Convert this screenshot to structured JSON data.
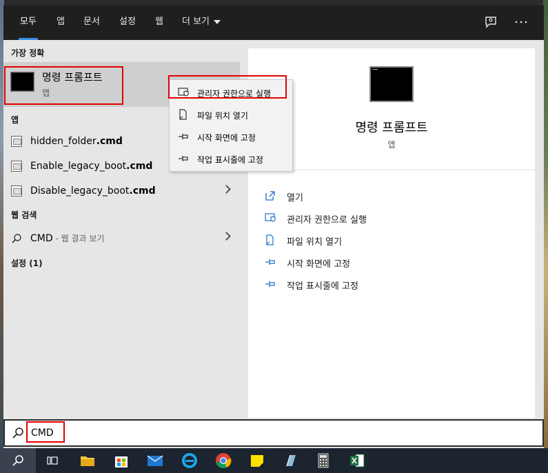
{
  "tabs": [
    {
      "label": "모두"
    },
    {
      "label": "앱"
    },
    {
      "label": "문서"
    },
    {
      "label": "설정"
    },
    {
      "label": "웹"
    },
    {
      "label": "더 보기"
    }
  ],
  "top_icons": [
    "feedback-icon",
    "more-options-icon"
  ],
  "best_match": {
    "heading": "가장 정확",
    "title": "명령 프롬프트",
    "subtitle": "앱"
  },
  "apps": {
    "heading": "앱",
    "items": [
      {
        "name": "hidden_folder",
        "ext": ".cmd"
      },
      {
        "name": "Enable_legacy_boot",
        "ext": ".cmd"
      },
      {
        "name": "Disable_legacy_boot",
        "ext": ".cmd"
      }
    ]
  },
  "web_search": {
    "heading": "웹 검색",
    "query": "CMD",
    "hint": " - 웹 결과 보기"
  },
  "settings": {
    "heading": "설정 (1)"
  },
  "context_menu": [
    {
      "label": "관리자 권한으로 실행",
      "icon": "shield-icon"
    },
    {
      "label": "파일 위치 열기",
      "icon": "folder-location-icon"
    },
    {
      "label": "시작 화면에 고정",
      "icon": "pin-icon"
    },
    {
      "label": "작업 표시줄에 고정",
      "icon": "pin-icon"
    }
  ],
  "preview": {
    "title": "명령 프롬프트",
    "subtitle": "앱",
    "actions": [
      {
        "label": "열기",
        "icon": "open-icon"
      },
      {
        "label": "관리자 권한으로 실행",
        "icon": "shield-icon"
      },
      {
        "label": "파일 위치 열기",
        "icon": "folder-location-icon"
      },
      {
        "label": "시작 화면에 고정",
        "icon": "pin-icon"
      },
      {
        "label": "작업 표시줄에 고정",
        "icon": "pin-icon"
      }
    ]
  },
  "search": {
    "value": "CMD",
    "placeholder": ""
  },
  "taskbar": [
    "search-icon",
    "task-view-icon",
    "file-explorer-icon",
    "store-icon",
    "mail-icon",
    "internet-explorer-icon",
    "chrome-icon",
    "sticky-notes-icon",
    "app-icon",
    "calculator-icon",
    "excel-icon"
  ],
  "colors": {
    "accent": "#3a8ee6",
    "highlight_border": "#e00000",
    "tab_bar": "#1f1f1f",
    "action_icon": "#1a6fc7"
  }
}
